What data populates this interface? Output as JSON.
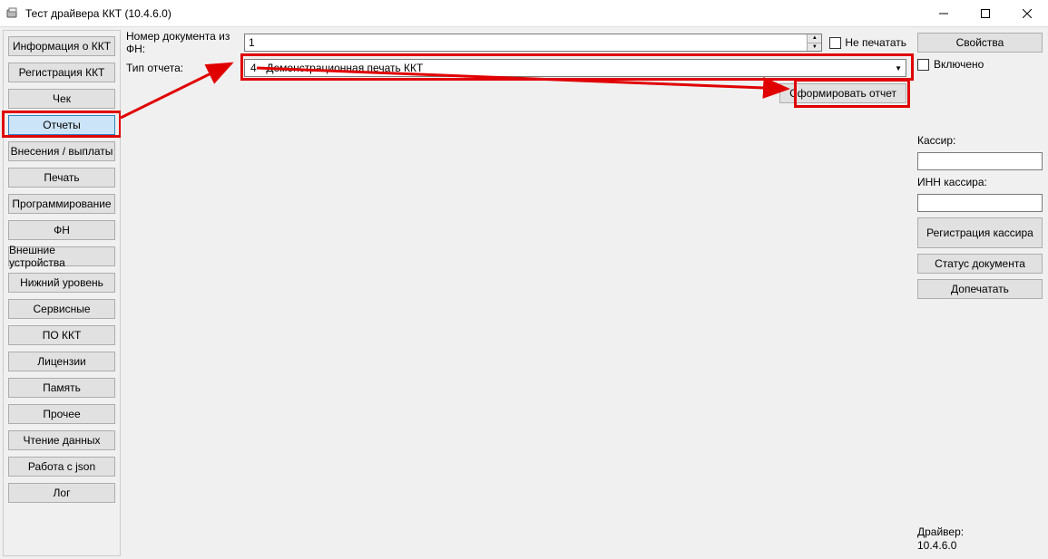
{
  "window": {
    "title": "Тест драйвера ККТ (10.4.6.0)"
  },
  "sidebar": {
    "items": [
      {
        "label": "Информация о ККТ"
      },
      {
        "label": "Регистрация ККТ"
      },
      {
        "label": "Чек"
      },
      {
        "label": "Отчеты",
        "selected": true
      },
      {
        "label": "Внесения / выплаты"
      },
      {
        "label": "Печать"
      },
      {
        "label": "Программирование"
      },
      {
        "label": "ФН"
      },
      {
        "label": "Внешние устройства"
      },
      {
        "label": "Нижний уровень"
      },
      {
        "label": "Сервисные"
      },
      {
        "label": "ПО ККТ"
      },
      {
        "label": "Лицензии"
      },
      {
        "label": "Память"
      },
      {
        "label": "Прочее"
      },
      {
        "label": "Чтение данных"
      },
      {
        "label": "Работа с json"
      },
      {
        "label": "Лог"
      }
    ]
  },
  "main": {
    "doc_number_label": "Номер документа из ФН:",
    "doc_number_value": "1",
    "no_print_label": "Не печатать",
    "report_type_label": "Тип отчета:",
    "report_type_value": "4 - Демонстрационная печать ККТ",
    "generate_report_label": "Сформировать отчет"
  },
  "right": {
    "properties_label": "Свойства",
    "enabled_label": "Включено",
    "cashier_label": "Кассир:",
    "cashier_value": "",
    "cashier_inn_label": "ИНН кассира:",
    "cashier_inn_value": "",
    "register_cashier_label": "Регистрация кассира",
    "doc_status_label": "Статус документа",
    "reprint_label": "Допечатать",
    "driver_label": "Драйвер:",
    "driver_version": "10.4.6.0"
  }
}
